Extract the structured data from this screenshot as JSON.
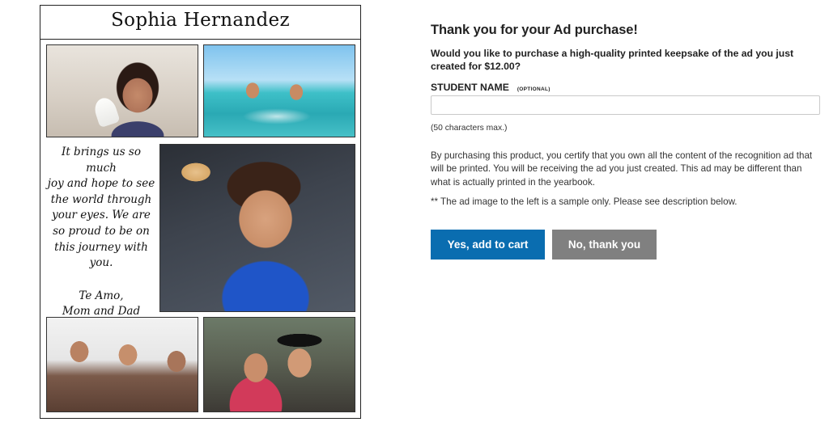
{
  "ad": {
    "student_name": "Sophia Hernandez",
    "message_lines": [
      "It brings us so much",
      "joy and hope to see",
      "the world through",
      "your eyes. We are",
      "so proud to be on",
      "this journey with",
      "you."
    ],
    "signature_lines": [
      "Te Amo,",
      "Mom and Dad"
    ],
    "photos": [
      "photo-girl-eating-ice-cream",
      "photo-kids-playing-in-sea",
      "photo-toddler-holding-bread",
      "photo-friends-at-table",
      "photo-graduate-with-mother"
    ]
  },
  "form": {
    "title": "Thank you for your Ad purchase!",
    "question": "Would you like to purchase a high-quality printed keepsake of the ad you just created for $12.00?",
    "student_name_label": "STUDENT NAME",
    "student_name_optional": "(OPTIONAL)",
    "student_name_value": "",
    "student_name_placeholder": "",
    "char_limit_hint": "(50 characters max.)",
    "disclaimer": "By purchasing this product, you certify that you own all the content of the recognition ad that will be printed. You will be receiving the ad you just created. This ad may be different than what is actually printed in the yearbook.",
    "sample_note": "** The ad image to the left is a sample only. Please see description below.",
    "yes_label": "Yes, add to cart",
    "no_label": "No, thank you"
  },
  "colors": {
    "primary_button": "#0a6db0",
    "secondary_button": "#808080"
  }
}
